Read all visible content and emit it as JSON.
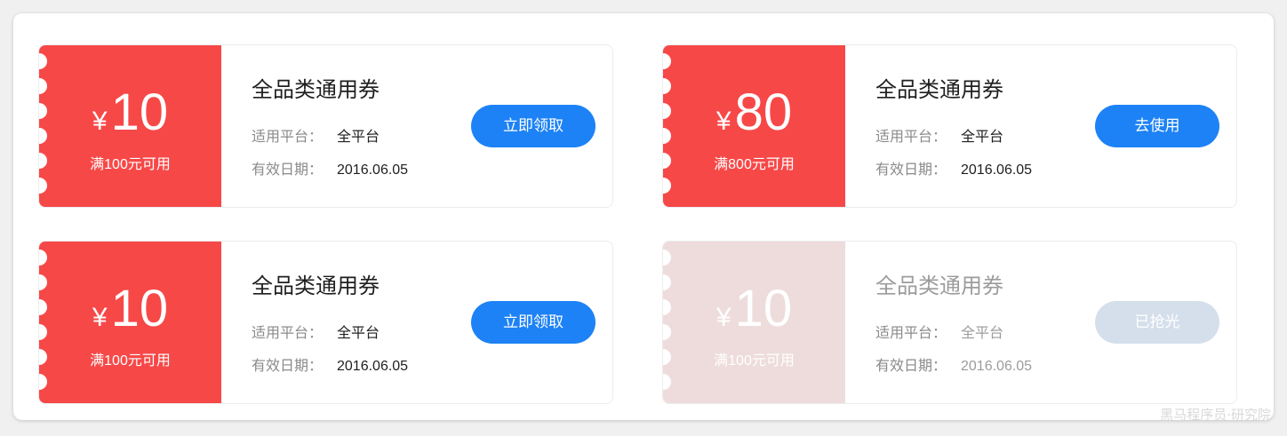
{
  "coupons": [
    {
      "currency": "¥",
      "amount": "10",
      "condition": "满100元可用",
      "title": "全品类通用券",
      "platform_label": "适用平台：",
      "platform": "全平台",
      "expiry_label": "有效日期：",
      "expiry": "2016.06.05",
      "button": "立即领取",
      "state": "available"
    },
    {
      "currency": "¥",
      "amount": "80",
      "condition": "满800元可用",
      "title": "全品类通用券",
      "platform_label": "适用平台：",
      "platform": "全平台",
      "expiry_label": "有效日期：",
      "expiry": "2016.06.05",
      "button": "去使用",
      "state": "owned"
    },
    {
      "currency": "¥",
      "amount": "10",
      "condition": "满100元可用",
      "title": "全品类通用券",
      "platform_label": "适用平台：",
      "platform": "全平台",
      "expiry_label": "有效日期：",
      "expiry": "2016.06.05",
      "button": "立即领取",
      "state": "available"
    },
    {
      "currency": "¥",
      "amount": "10",
      "condition": "满100元可用",
      "title": "全品类通用券",
      "platform_label": "适用平台：",
      "platform": "全平台",
      "expiry_label": "有效日期：",
      "expiry": "2016.06.05",
      "button": "已抢光",
      "state": "sold-out"
    }
  ],
  "colors": {
    "stub": "#f74848",
    "stub_used": "#eedcdc",
    "button": "#1d82f5",
    "button_disabled": "#d5dfeb"
  },
  "watermark": "黑马程序员·研究院"
}
